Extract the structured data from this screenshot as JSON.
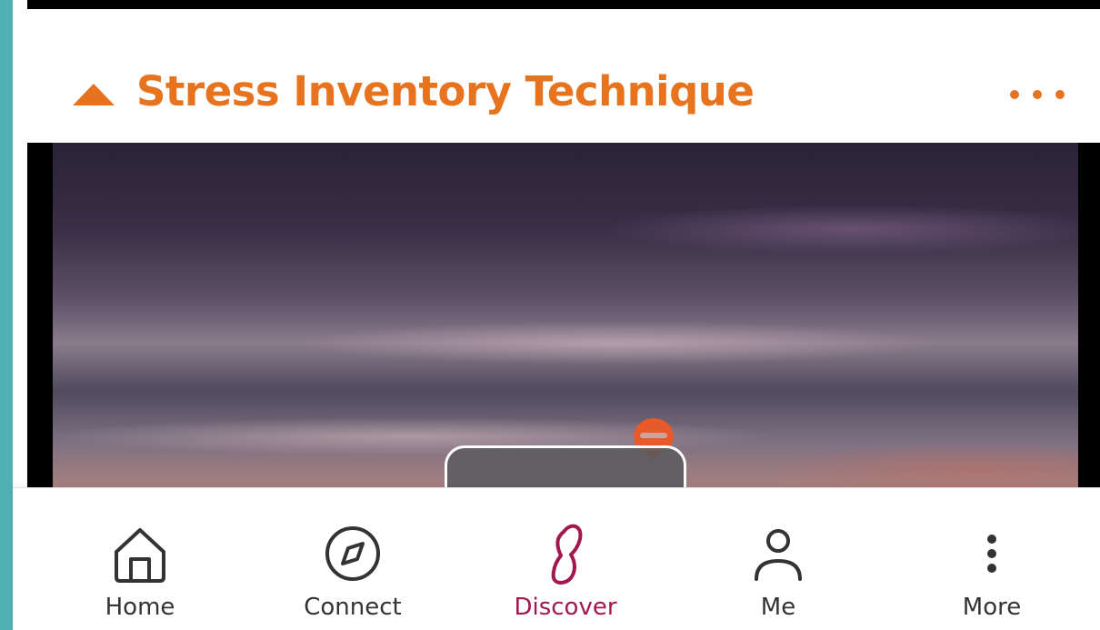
{
  "section": {
    "title": "Stress Inventory Technique"
  },
  "colors": {
    "accent": "#e8731f",
    "active_nav": "#a3174f",
    "nav_text": "#333333",
    "left_rail": "#4fb1b4"
  },
  "bottom_nav": {
    "items": [
      {
        "label": "Home",
        "icon": "home-icon",
        "active": false
      },
      {
        "label": "Connect",
        "icon": "compass-icon",
        "active": false
      },
      {
        "label": "Discover",
        "icon": "discover-icon",
        "active": true
      },
      {
        "label": "Me",
        "icon": "person-icon",
        "active": false
      },
      {
        "label": "More",
        "icon": "vertical-dots-icon",
        "active": false
      }
    ]
  }
}
